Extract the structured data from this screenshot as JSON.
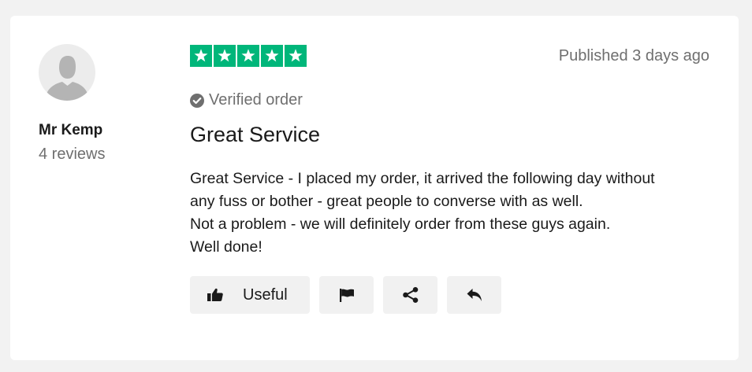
{
  "reviewer": {
    "name": "Mr Kemp",
    "review_count": "4 reviews"
  },
  "review": {
    "rating": 5,
    "rating_max": 5,
    "published": "Published 3 days ago",
    "verified_label": "Verified order",
    "title": "Great Service",
    "body_lines": [
      "Great Service - I placed my order, it arrived the following day without",
      "any fuss or bother - great people to converse with as well.",
      "Not a problem - we will definitely order from these guys again.",
      "Well done!"
    ]
  },
  "actions": {
    "useful_label": "Useful",
    "useful_icon": "thumbs-up-icon",
    "flag_icon": "flag-icon",
    "share_icon": "share-icon",
    "reply_icon": "reply-icon"
  },
  "colors": {
    "star_green": "#00b67a",
    "page_bg": "#f2f2f2",
    "card_bg": "#ffffff",
    "button_bg": "#f1f1f1",
    "muted_text": "#6f6f6f"
  }
}
